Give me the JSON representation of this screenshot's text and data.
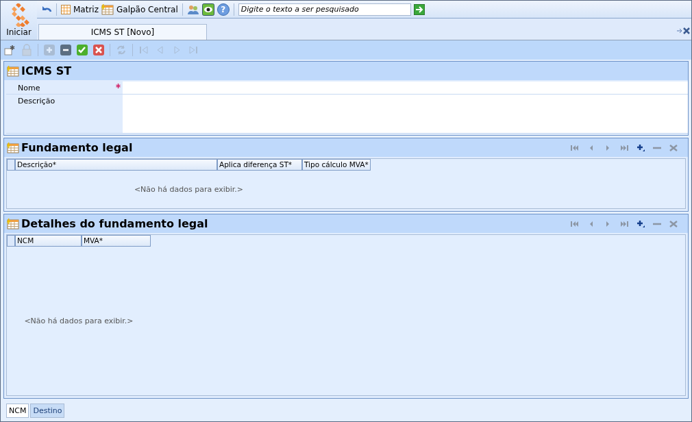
{
  "app_menu": {
    "label": "Iniciar"
  },
  "quick_toolbar": {
    "company": "Matriz",
    "warehouse": "Galpão Central",
    "help": "?",
    "search": {
      "placeholder": "Digite o texto a ser pesquisado"
    }
  },
  "document_tabs": [
    {
      "label": "ICMS ST [Novo]",
      "selected": true
    }
  ],
  "toolbar": [
    {
      "kind": "new",
      "disabled": false
    },
    {
      "kind": "lock",
      "disabled": true
    },
    {
      "kind": "add",
      "disabled": true
    },
    {
      "kind": "remove",
      "disabled": false
    },
    {
      "kind": "save",
      "disabled": false
    },
    {
      "kind": "cancel",
      "disabled": false
    },
    {
      "kind": "refresh",
      "disabled": true
    },
    {
      "kind": "first",
      "disabled": true
    },
    {
      "kind": "prev",
      "disabled": true
    },
    {
      "kind": "next",
      "disabled": true
    },
    {
      "kind": "last",
      "disabled": true
    }
  ],
  "form": {
    "title": "ICMS ST",
    "fields": [
      {
        "label": "Nome",
        "required": true,
        "kind": "line"
      },
      {
        "label": "Descrição",
        "required": false,
        "kind": "area"
      }
    ]
  },
  "grids": [
    {
      "title": "Fundamento legal",
      "columns": [
        "Descrição*",
        "Aplica diferença ST*",
        "Tipo cálculo MVA*"
      ],
      "empty_text": "<Não há dados para exibir.>",
      "nav": [
        {
          "kind": "first",
          "disabled": true
        },
        {
          "kind": "prev",
          "disabled": true
        },
        {
          "kind": "next",
          "disabled": true
        },
        {
          "kind": "last",
          "disabled": true
        },
        {
          "kind": "add",
          "disabled": false
        },
        {
          "kind": "remove",
          "disabled": true
        },
        {
          "kind": "delete",
          "disabled": true
        }
      ]
    },
    {
      "title": "Detalhes do fundamento legal",
      "columns": [
        "NCM",
        "MVA*"
      ],
      "empty_text": "<Não há dados para exibir.>",
      "nav": [
        {
          "kind": "first",
          "disabled": true
        },
        {
          "kind": "prev",
          "disabled": true
        },
        {
          "kind": "next",
          "disabled": true
        },
        {
          "kind": "last",
          "disabled": true
        },
        {
          "kind": "add",
          "disabled": false
        },
        {
          "kind": "remove",
          "disabled": true
        },
        {
          "kind": "delete",
          "disabled": true
        }
      ]
    }
  ],
  "bottom_tabs": [
    {
      "label": "NCM",
      "selected": true
    },
    {
      "label": "Destino",
      "selected": false
    }
  ]
}
